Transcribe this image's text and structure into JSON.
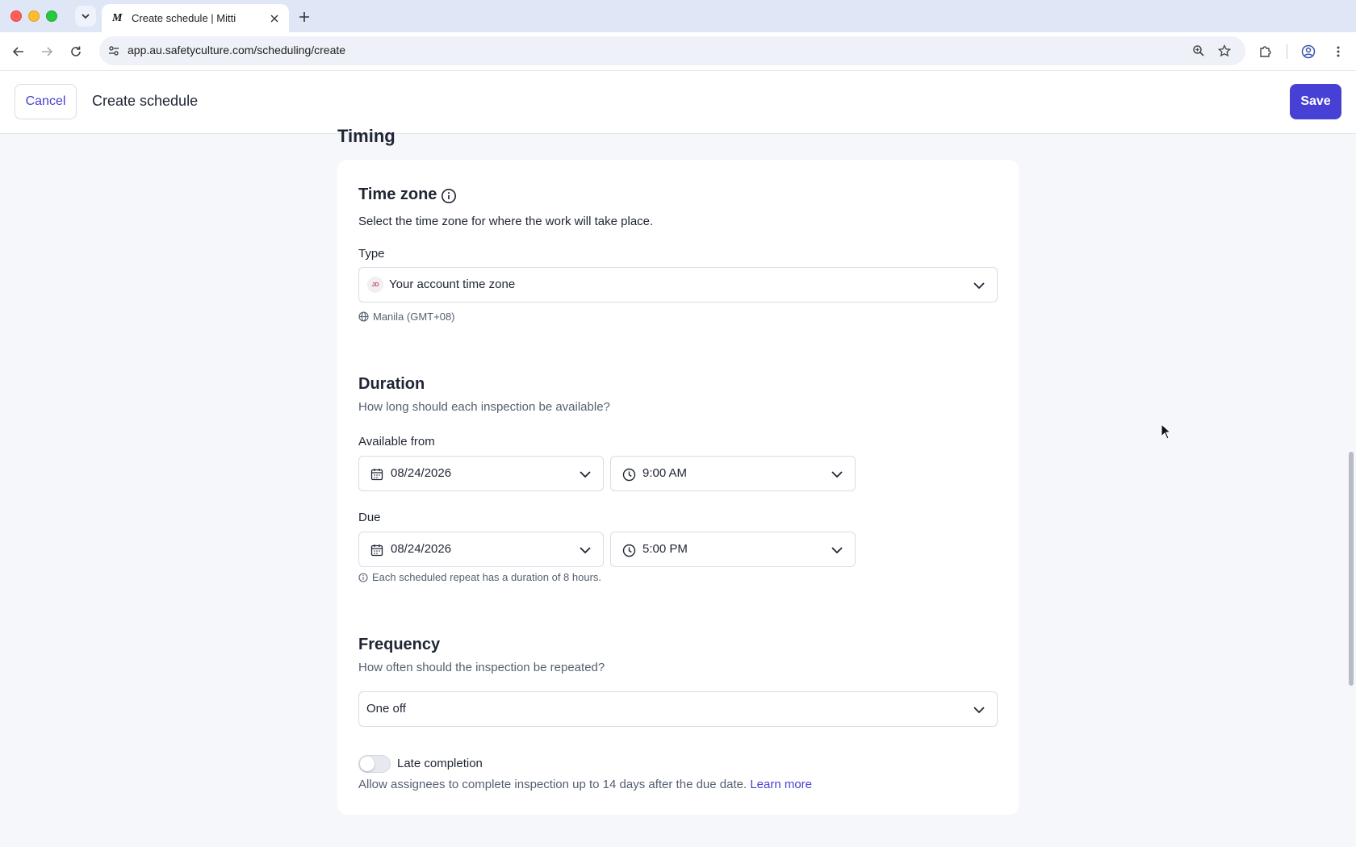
{
  "browser": {
    "tab_title": "Create schedule | Mitti",
    "tab_favicon": "M",
    "url": "app.au.safetyculture.com/scheduling/create"
  },
  "header": {
    "cancel_label": "Cancel",
    "title": "Create schedule",
    "save_label": "Save"
  },
  "section_title": "Timing",
  "timezone": {
    "title": "Time zone",
    "description": "Select the time zone for where the work will take place.",
    "type_label": "Type",
    "avatar_initials": "JD",
    "type_value": "Your account time zone",
    "zone_note": "Manila (GMT+08)"
  },
  "duration": {
    "title": "Duration",
    "description": "How long should each inspection be available?",
    "available_from_label": "Available from",
    "available_from_date": "08/24/2026",
    "available_from_time": "9:00 AM",
    "due_label": "Due",
    "due_date": "08/24/2026",
    "due_time": "5:00 PM",
    "duration_note": "Each scheduled repeat has a duration of 8 hours."
  },
  "frequency": {
    "title": "Frequency",
    "description": "How often should the inspection be repeated?",
    "value": "One off"
  },
  "late_completion": {
    "label": "Late completion",
    "enabled": false,
    "description": "Allow assignees to complete inspection up to 14 days after the due date.",
    "learn_more": "Learn more"
  },
  "colors": {
    "accent": "#4740d4",
    "muted_text": "#545f70"
  }
}
